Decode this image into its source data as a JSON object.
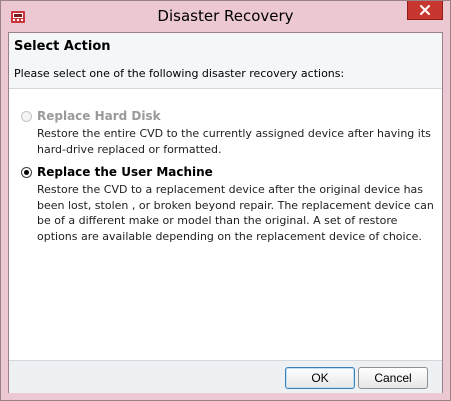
{
  "window": {
    "title": "Disaster Recovery",
    "accent_color": "#ecc9d2",
    "close_color": "#c7372f",
    "app_icon": "disaster-recovery-icon",
    "close_icon": "close-icon"
  },
  "header": {
    "title": "Select Action",
    "subtitle": "Please select one of the following disaster recovery actions:"
  },
  "options": [
    {
      "label": "Replace Hard Disk",
      "description": "Restore the entire CVD to the currently assigned device after having its hard-drive replaced or formatted.",
      "selected": false,
      "enabled": false
    },
    {
      "label": "Replace the User Machine",
      "description": "Restore the CVD to a replacement device after the original device has been lost, stolen , or broken beyond repair. The replacement device can be of a different make or model than the original. A set of restore options are available depending on the replacement device of choice.",
      "selected": true,
      "enabled": true
    }
  ],
  "footer": {
    "ok_label": "OK",
    "cancel_label": "Cancel"
  }
}
